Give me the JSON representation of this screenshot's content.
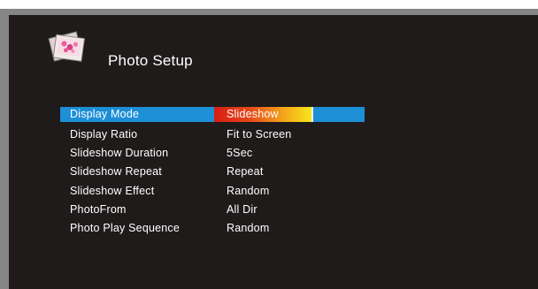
{
  "header": {
    "title": "Photo Setup",
    "icon": "photo-setup-icon"
  },
  "colors": {
    "panel_background": "#1f1b1b",
    "frame": "#858585",
    "selection_bar": "#1d8fd6",
    "selected_value_gradient": [
      "#d81d14",
      "#f6e61b"
    ],
    "text": "#ffffff"
  },
  "menu": {
    "items": [
      {
        "label": "Display Mode",
        "value": "Slideshow",
        "selected": true
      },
      {
        "label": "Display Ratio",
        "value": "Fit to Screen",
        "selected": false
      },
      {
        "label": "Slideshow Duration",
        "value": "5Sec",
        "selected": false
      },
      {
        "label": "Slideshow Repeat",
        "value": "Repeat",
        "selected": false
      },
      {
        "label": "Slideshow Effect",
        "value": "Random",
        "selected": false
      },
      {
        "label": "PhotoFrom",
        "value": "All Dir",
        "selected": false
      },
      {
        "label": "Photo Play Sequence",
        "value": "Random",
        "selected": false
      }
    ]
  }
}
